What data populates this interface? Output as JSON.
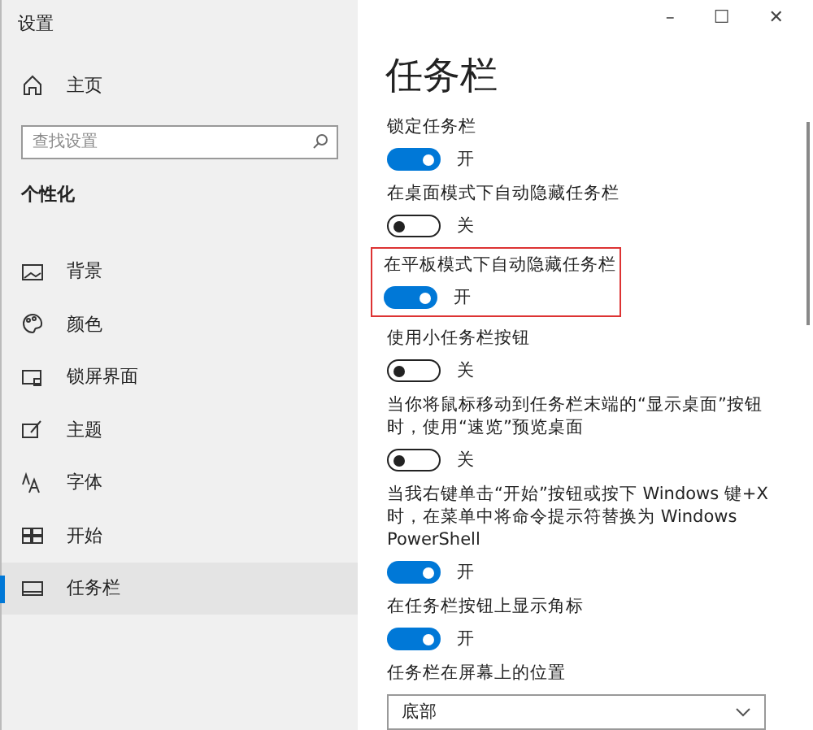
{
  "window": {
    "title": "设置",
    "controls": [
      "–",
      "☐",
      "✕"
    ]
  },
  "sidebar": {
    "home": "主页",
    "search": {
      "placeholder": "查找设置"
    },
    "section": "个性化",
    "items": [
      {
        "label": "背景",
        "selected": false
      },
      {
        "label": "颜色",
        "selected": false
      },
      {
        "label": "锁屏界面",
        "selected": false
      },
      {
        "label": "主题",
        "selected": false
      },
      {
        "label": "字体",
        "selected": false
      },
      {
        "label": "开始",
        "selected": false
      },
      {
        "label": "任务栏",
        "selected": true
      }
    ]
  },
  "page": {
    "title": "任务栏",
    "settings": [
      {
        "kind": "toggle",
        "label": "锁定任务栏",
        "on": true,
        "state": "开",
        "highlighted": false
      },
      {
        "kind": "toggle",
        "label": "在桌面模式下自动隐藏任务栏",
        "on": false,
        "state": "关",
        "highlighted": false
      },
      {
        "kind": "toggle",
        "label": "在平板模式下自动隐藏任务栏",
        "on": true,
        "state": "开",
        "highlighted": true
      },
      {
        "kind": "toggle",
        "label": "使用小任务栏按钮",
        "on": false,
        "state": "关",
        "highlighted": false
      },
      {
        "kind": "toggle",
        "label": "当你将鼠标移动到任务栏末端的“显示桌面”按钮时，使用“速览”预览桌面",
        "on": false,
        "state": "关",
        "highlighted": false
      },
      {
        "kind": "toggle",
        "label": "当我右键单击“开始”按钮或按下 Windows 键+X 时，在菜单中将命令提示符替换为 Windows PowerShell",
        "on": true,
        "state": "开",
        "highlighted": false
      },
      {
        "kind": "toggle",
        "label": "在任务栏按钮上显示角标",
        "on": true,
        "state": "开",
        "highlighted": false
      },
      {
        "kind": "dropdown",
        "label": "任务栏在屏幕上的位置",
        "value": "底部",
        "highlighted": false
      }
    ]
  }
}
